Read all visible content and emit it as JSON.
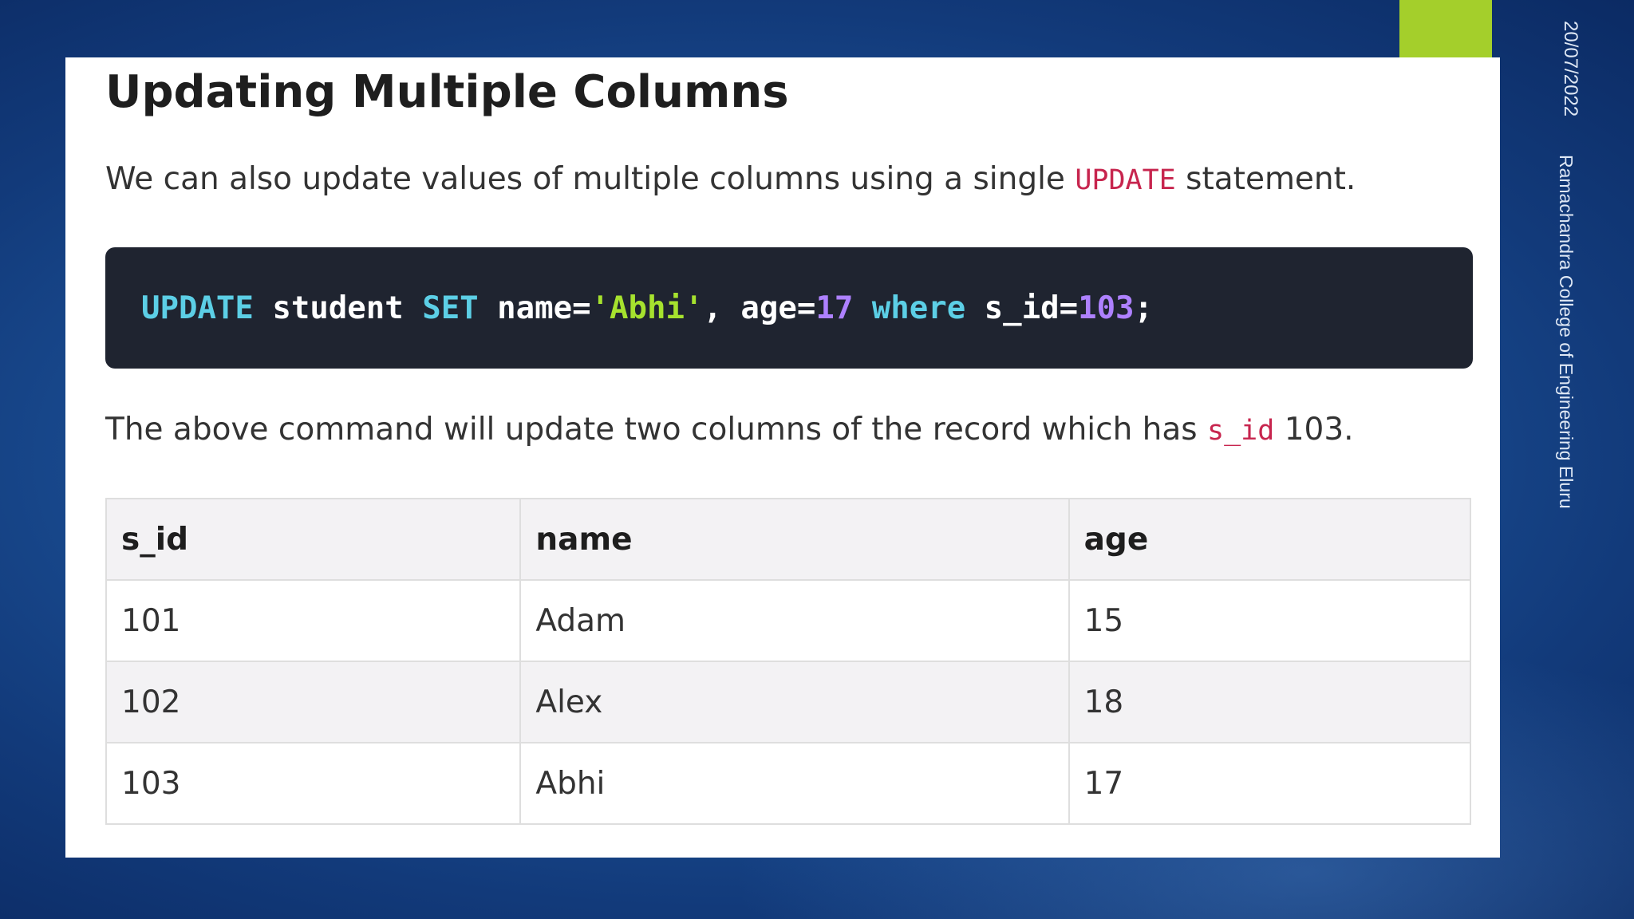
{
  "colors": {
    "accent_bar": "#a4cf2b",
    "inline_code": "#c7254e",
    "code_background": "#1f2430",
    "keyword": "#5ccfe6",
    "identifier": "#ffffff",
    "string": "#a6e22e",
    "number": "#ae81ff",
    "header_row_bg": "#f3f2f4",
    "zebra_row_bg": "#f3f2f4",
    "body_row_bg": "#ffffff"
  },
  "slide": {
    "heading": "Updating Multiple Columns",
    "intro": {
      "before": "We can also update values of multiple columns using a single ",
      "code": "UPDATE",
      "after": " statement."
    },
    "code_tokens": [
      {
        "text": "UPDATE",
        "kind": "keyword"
      },
      {
        "text": " student ",
        "kind": "identifier"
      },
      {
        "text": "SET",
        "kind": "keyword"
      },
      {
        "text": " name=",
        "kind": "identifier"
      },
      {
        "text": "'Abhi'",
        "kind": "string"
      },
      {
        "text": ", age=",
        "kind": "identifier"
      },
      {
        "text": "17",
        "kind": "number"
      },
      {
        "text": " ",
        "kind": "identifier"
      },
      {
        "text": "where",
        "kind": "keyword"
      },
      {
        "text": " s_id=",
        "kind": "identifier"
      },
      {
        "text": "103",
        "kind": "number"
      },
      {
        "text": ";",
        "kind": "identifier"
      }
    ],
    "explain": {
      "before": "The above command will update two columns of the record which has ",
      "code": "s_id",
      "after": " 103."
    },
    "table": {
      "headers": [
        "s_id",
        "name",
        "age"
      ],
      "rows": [
        [
          "101",
          "Adam",
          "15"
        ],
        [
          "102",
          "Alex",
          "18"
        ],
        [
          "103",
          "Abhi",
          "17"
        ]
      ]
    }
  },
  "side": {
    "date": "20/07/2022",
    "college": "Ramachandra College of Engineering  Eluru"
  }
}
